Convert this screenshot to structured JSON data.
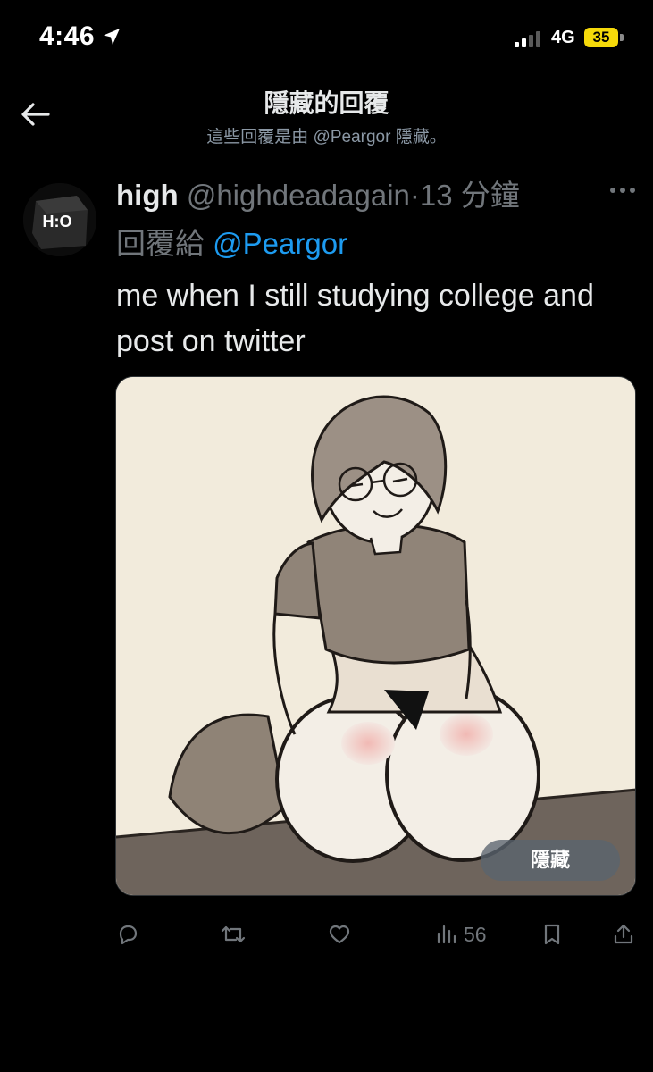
{
  "status_bar": {
    "time": "4:46",
    "network": "4G",
    "battery": "35",
    "battery_color": "#f5d90a",
    "icons": [
      "location-arrow-icon",
      "signal-bars-icon"
    ]
  },
  "header": {
    "title": "隱藏的回覆",
    "subtitle": "這些回覆是由 @Peargor 隱藏。",
    "back_icon": "back-arrow-icon"
  },
  "tweet": {
    "display_name": "high",
    "handle": "@highdeadagain",
    "separator": "·",
    "time": "13 分鐘",
    "reply_prefix": "回覆給",
    "reply_to": "@Peargor",
    "text": "me when I still studying college and post on twitter",
    "avatar_text": "H:O",
    "media": {
      "hide_label": "隱藏"
    }
  },
  "actions": {
    "views": "56",
    "icons": [
      "reply-icon",
      "retweet-icon",
      "like-icon",
      "views-icon",
      "bookmark-icon",
      "share-icon"
    ]
  },
  "colors": {
    "accent": "#1d9bf0",
    "muted": "#71767b",
    "background": "#000000"
  }
}
